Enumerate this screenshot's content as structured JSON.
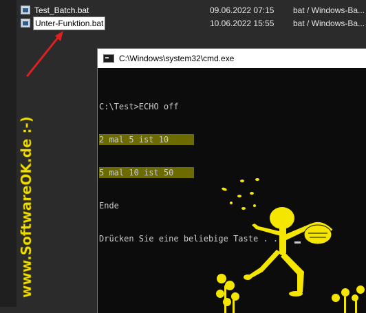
{
  "explorer": {
    "files": [
      {
        "name": "Test_Batch.bat",
        "date": "09.06.2022 07:15",
        "type": "bat / Windows-Ba...",
        "selected": false
      },
      {
        "name": "Unter-Funktion.bat",
        "date": "10.06.2022 15:55",
        "type": "bat / Windows-Ba...",
        "selected": true
      }
    ]
  },
  "cmd": {
    "title": "C:\\Windows\\system32\\cmd.exe",
    "lines": [
      "C:\\Test>ECHO off",
      "2 mal 5 ist 10",
      "5 mal 10 ist 50",
      "Ende",
      "Drücken Sie eine beliebige Taste . . . "
    ]
  },
  "watermark": {
    "text": "www.SoftwareOK.de :-)"
  },
  "colors": {
    "arrow": "#e02020",
    "watermark": "#f0e000",
    "highlight": "#6b6b00",
    "console_text": "#cccccc",
    "clipart": "#f5e600"
  },
  "icons": {
    "file": "bat-file-icon",
    "cmd": "cmd-window-icon"
  }
}
